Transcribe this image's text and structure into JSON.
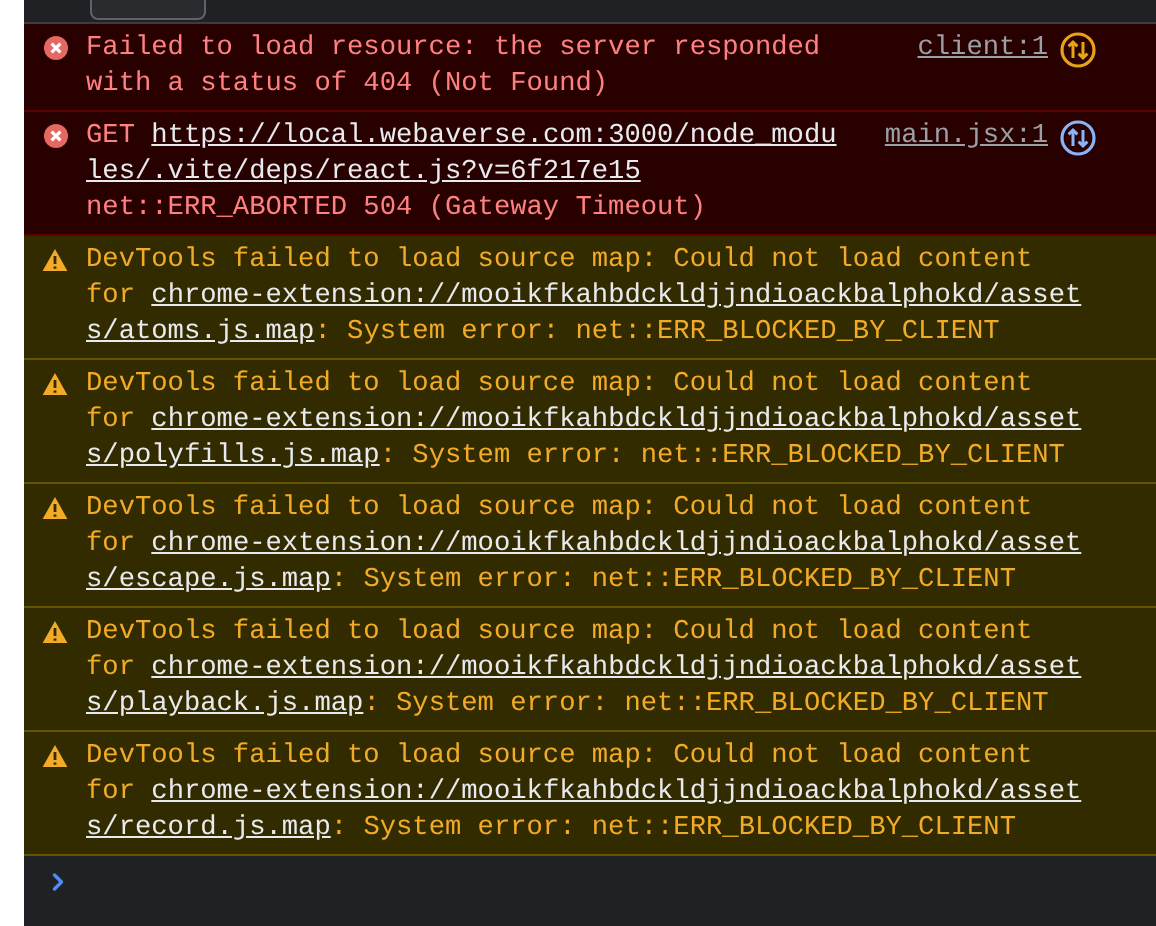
{
  "console": {
    "entries": [
      {
        "kind": "error",
        "headline": "Failed to load resource: the server responded with a status of 404 (Not Found)",
        "source": "client:1",
        "color": "#e8a317"
      },
      {
        "kind": "error",
        "prefix": "GET",
        "link_lines": [
          "https://local.webaverse.com:3000/node_modu",
          "les/.vite/deps/react.js?v=6f217e15"
        ],
        "detail": "net::ERR_ABORTED 504 (Gateway Timeout)",
        "source": "main.jsx:1",
        "color": "#8ab4f8"
      },
      {
        "kind": "warning",
        "headline": "DevTools failed to load source map: Could not load content",
        "prefix": "for",
        "link_lines": [
          "chrome-extension://mooikfkahbdckldjjndioackbalphokd/asset",
          "s/atoms.js.map"
        ],
        "suffix": ": System error: net::ERR_BLOCKED_BY_CLIENT"
      },
      {
        "kind": "warning",
        "headline": "DevTools failed to load source map: Could not load content",
        "prefix": "for",
        "link_lines": [
          "chrome-extension://mooikfkahbdckldjjndioackbalphokd/asset",
          "s/polyfills.js.map"
        ],
        "suffix": ": System error: net::ERR_BLOCKED_BY_CLIENT"
      },
      {
        "kind": "warning",
        "headline": "DevTools failed to load source map: Could not load content",
        "prefix": "for",
        "link_lines": [
          "chrome-extension://mooikfkahbdckldjjndioackbalphokd/asset",
          "s/escape.js.map"
        ],
        "suffix": ": System error: net::ERR_BLOCKED_BY_CLIENT"
      },
      {
        "kind": "warning",
        "headline": "DevTools failed to load source map: Could not load content",
        "prefix": "for",
        "link_lines": [
          "chrome-extension://mooikfkahbdckldjjndioackbalphokd/asset",
          "s/playback.js.map"
        ],
        "suffix": ": System error: net::ERR_BLOCKED_BY_CLIENT"
      },
      {
        "kind": "warning",
        "headline": "DevTools failed to load source map: Could not load content",
        "prefix": "for",
        "link_lines": [
          "chrome-extension://mooikfkahbdckldjjndioackbalphokd/asset",
          "s/record.js.map"
        ],
        "suffix": ": System error: net::ERR_BLOCKED_BY_CLIENT"
      }
    ]
  }
}
